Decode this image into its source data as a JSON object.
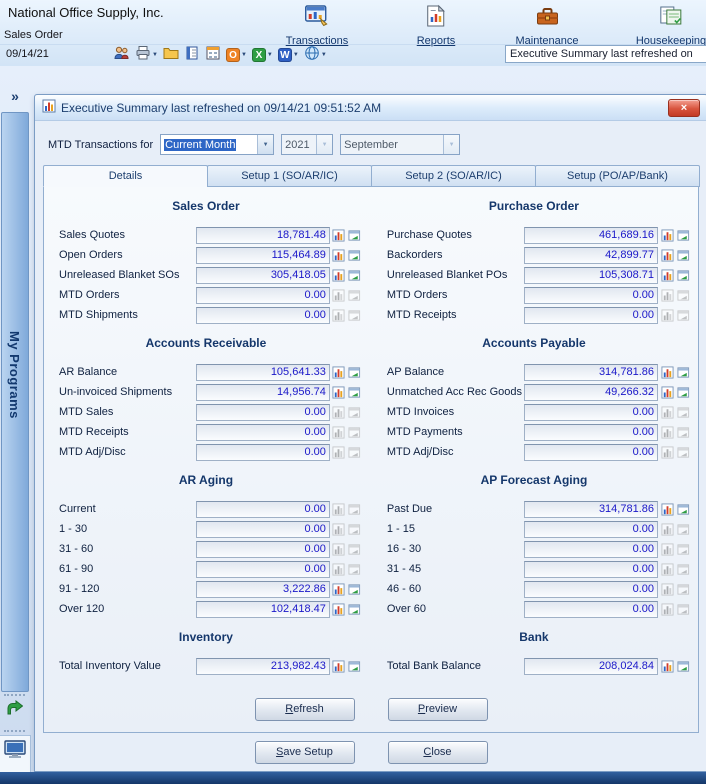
{
  "app": {
    "company": "National Office Supply, Inc.",
    "module": "Sales Order",
    "date": "09/14/21",
    "sidebar_label": "My Programs",
    "sidebar_expand": "»",
    "status_box": "Executive Summary last refreshed on",
    "nav": [
      {
        "label": "Transactions",
        "icon": "transactions"
      },
      {
        "label": "Reports",
        "icon": "reports"
      },
      {
        "label": "Maintenance",
        "icon": "maintenance"
      },
      {
        "label": "Housekeeping",
        "icon": "housekeeping"
      }
    ],
    "toolbar": [
      {
        "name": "contacts-icon",
        "icon": "users"
      },
      {
        "name": "print-button",
        "icon": "printer",
        "dropdown": true
      },
      {
        "name": "folder-icon",
        "icon": "folder"
      },
      {
        "name": "ledger-icon",
        "icon": "ledger"
      },
      {
        "name": "window-icon",
        "icon": "calcwin"
      },
      {
        "name": "outlook-export-button",
        "badge": "O",
        "color": "#ef8324",
        "dropdown": true
      },
      {
        "name": "excel-export-button",
        "badge": "X",
        "color": "#2e9e44",
        "dropdown": true
      },
      {
        "name": "word-export-button",
        "badge": "W",
        "color": "#2e5fc4",
        "dropdown": true
      },
      {
        "name": "web-button",
        "icon": "globe",
        "dropdown": true
      }
    ]
  },
  "dialog": {
    "title": "Executive Summary last refreshed on 09/14/21 09:51:52 AM",
    "close_glyph": "×",
    "mtd": {
      "label": "MTD Transactions for",
      "period": "Current Month",
      "year": "2021",
      "month": "September"
    },
    "tabs": [
      {
        "label": "Details",
        "active": true
      },
      {
        "label": "Setup 1 (SO/AR/IC)",
        "active": false
      },
      {
        "label": "Setup 2 (SO/AR/IC)",
        "active": false
      },
      {
        "label": "Setup (PO/AP/Bank)",
        "active": false
      }
    ],
    "columns": [
      {
        "sections": [
          {
            "title": "Sales Order",
            "rows": [
              {
                "label": "Sales Quotes",
                "value": "18,781.48"
              },
              {
                "label": "Open Orders",
                "value": "115,464.89"
              },
              {
                "label": "Unreleased Blanket SOs",
                "value": "305,418.05"
              },
              {
                "label": "MTD Orders",
                "value": "0.00"
              },
              {
                "label": "MTD Shipments",
                "value": "0.00"
              }
            ]
          },
          {
            "title": "Accounts Receivable",
            "rows": [
              {
                "label": "AR Balance",
                "value": "105,641.33"
              },
              {
                "label": "Un-invoiced Shipments",
                "value": "14,956.74"
              },
              {
                "label": "MTD Sales",
                "value": "0.00"
              },
              {
                "label": "MTD Receipts",
                "value": "0.00"
              },
              {
                "label": "MTD Adj/Disc",
                "value": "0.00"
              }
            ]
          },
          {
            "title": "AR Aging",
            "rows": [
              {
                "label": "Current",
                "value": "0.00"
              },
              {
                "label": "1 - 30",
                "value": "0.00"
              },
              {
                "label": "31 - 60",
                "value": "0.00"
              },
              {
                "label": "61 - 90",
                "value": "0.00"
              },
              {
                "label": "91 - 120",
                "value": "3,222.86"
              },
              {
                "label": "Over 120",
                "value": "102,418.47"
              }
            ]
          },
          {
            "title": "Inventory",
            "rows": [
              {
                "label": "Total Inventory Value",
                "value": "213,982.43"
              }
            ]
          }
        ]
      },
      {
        "sections": [
          {
            "title": "Purchase Order",
            "rows": [
              {
                "label": "Purchase Quotes",
                "value": "461,689.16"
              },
              {
                "label": "Backorders",
                "value": "42,899.77"
              },
              {
                "label": "Unreleased Blanket POs",
                "value": "105,308.71"
              },
              {
                "label": "MTD Orders",
                "value": "0.00"
              },
              {
                "label": "MTD Receipts",
                "value": "0.00"
              }
            ]
          },
          {
            "title": "Accounts Payable",
            "rows": [
              {
                "label": "AP Balance",
                "value": "314,781.86"
              },
              {
                "label": "Unmatched Acc Rec Goods",
                "value": "49,266.32"
              },
              {
                "label": "MTD Invoices",
                "value": "0.00"
              },
              {
                "label": "MTD Payments",
                "value": "0.00"
              },
              {
                "label": "MTD Adj/Disc",
                "value": "0.00"
              }
            ]
          },
          {
            "title": "AP Forecast Aging",
            "rows": [
              {
                "label": "Past Due",
                "value": "314,781.86"
              },
              {
                "label": "1 - 15",
                "value": "0.00"
              },
              {
                "label": "16 - 30",
                "value": "0.00"
              },
              {
                "label": "31 - 45",
                "value": "0.00"
              },
              {
                "label": "46 - 60",
                "value": "0.00"
              },
              {
                "label": "Over 60",
                "value": "0.00"
              }
            ]
          },
          {
            "title": "Bank",
            "rows": [
              {
                "label": "Total Bank Balance",
                "value": "208,024.84"
              }
            ]
          }
        ]
      }
    ],
    "buttons": {
      "refresh": "Refresh",
      "preview": "Preview",
      "save_setup": "Save Setup",
      "close": "Close"
    }
  }
}
